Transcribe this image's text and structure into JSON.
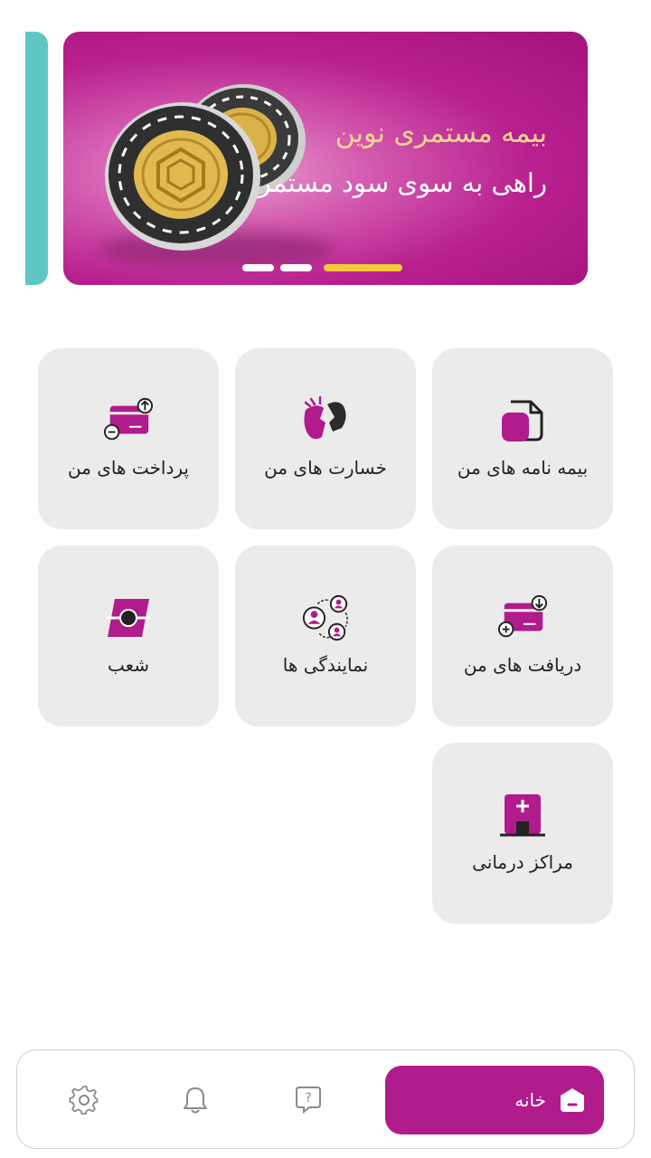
{
  "banner": {
    "line1": "بیمه مستمری نوین",
    "line2": "راهی به سوی سود مستمر",
    "slide_count": 3,
    "active_slide": 3
  },
  "tiles": [
    {
      "label": "بیمه نامه های من",
      "icon": "policy-document-icon"
    },
    {
      "label": "خسارت های من",
      "icon": "broken-damage-icon"
    },
    {
      "label": "پرداخت های من",
      "icon": "card-payment-icon"
    },
    {
      "label": "دریافت های من",
      "icon": "card-receive-icon"
    },
    {
      "label": "نمایندگی ها",
      "icon": "agents-network-icon"
    },
    {
      "label": "شعب",
      "icon": "branch-location-icon"
    },
    {
      "label": "مراکز درمانی",
      "icon": "hospital-icon"
    }
  ],
  "nav": {
    "home_label": "خانه",
    "items": [
      "home-icon",
      "help-icon",
      "bell-icon",
      "gear-icon"
    ]
  },
  "colors": {
    "brand": "#b01c8c",
    "tile_bg": "#ebebeb",
    "accent_teal": "#5fc6c4",
    "accent_gold": "#f6c93c"
  }
}
